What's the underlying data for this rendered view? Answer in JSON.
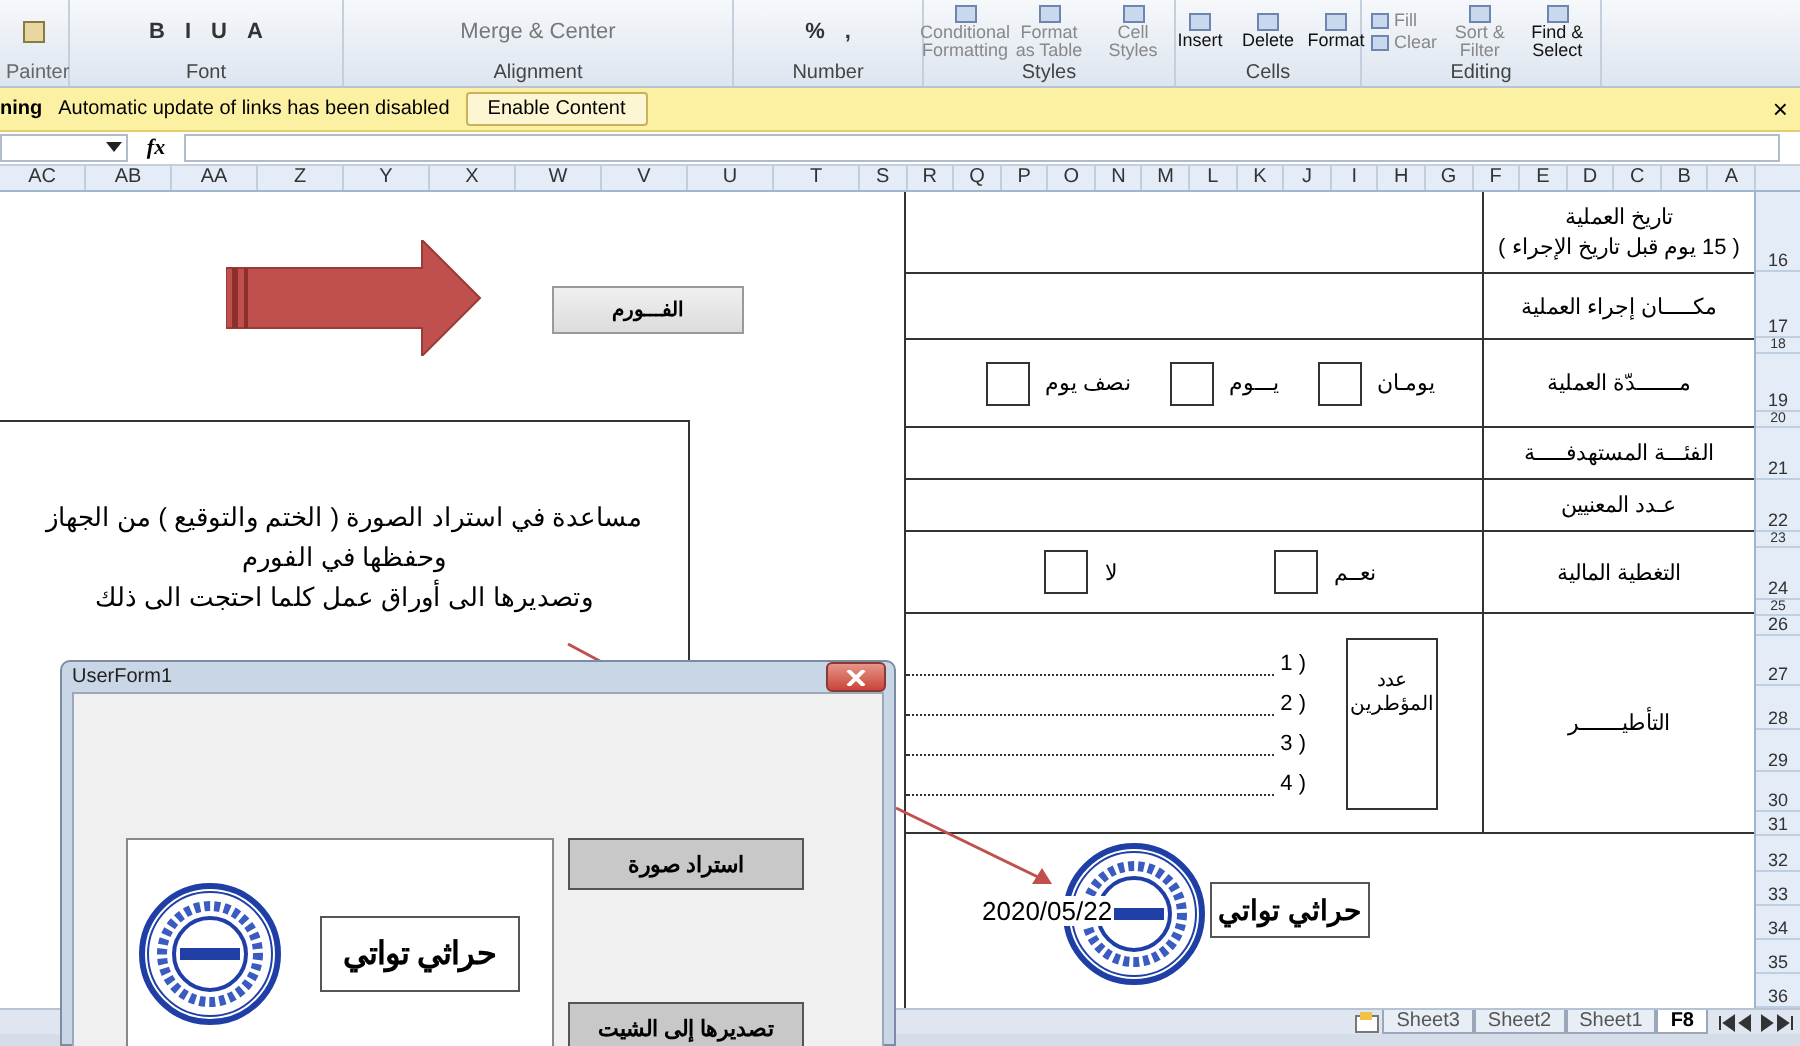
{
  "ribbon": {
    "groups": [
      {
        "label": "Editing",
        "kind": "editing",
        "stack": [
          {
            "label": "Fill",
            "disabled": true
          },
          {
            "label": "Clear",
            "disabled": true
          }
        ],
        "items": [
          {
            "label": "Find & Select",
            "disabled": false
          },
          {
            "label": "Sort & Filter",
            "disabled": true
          }
        ]
      },
      {
        "label": "Cells",
        "kind": "large",
        "items": [
          {
            "label": "Format",
            "disabled": false
          },
          {
            "label": "Delete",
            "disabled": false
          },
          {
            "label": "Insert",
            "disabled": false
          }
        ]
      },
      {
        "label": "Styles",
        "kind": "large",
        "items": [
          {
            "label": "Cell Styles",
            "disabled": true
          },
          {
            "label": "Format as Table",
            "disabled": true
          },
          {
            "label": "Conditional Formatting",
            "disabled": true
          }
        ]
      },
      {
        "label": "Number",
        "kind": "small",
        "items": [
          {
            "label": ","
          },
          {
            "label": "%"
          }
        ]
      },
      {
        "label": "Alignment",
        "kind": "small",
        "items": [
          {
            "label": "Merge & Center"
          }
        ]
      },
      {
        "label": "Font",
        "kind": "small",
        "items": [
          {
            "label": "A"
          },
          {
            "label": "U"
          },
          {
            "label": "I"
          },
          {
            "label": "B"
          }
        ]
      },
      {
        "label": "Painter",
        "kind": "clip"
      }
    ]
  },
  "message_bar": {
    "title": "ning",
    "text": "Automatic update of links has been disabled",
    "button": "Enable Content",
    "close": "×"
  },
  "formula_bar": {
    "fx": "fx"
  },
  "columns": [
    "A",
    "B",
    "C",
    "D",
    "E",
    "F",
    "G",
    "H",
    "I",
    "J",
    "K",
    "L",
    "M",
    "N",
    "O",
    "P",
    "Q",
    "R",
    "S",
    "T",
    "U",
    "V",
    "W",
    "X",
    "Y",
    "Z",
    "AA",
    "AB",
    "AC"
  ],
  "rows": [
    "16",
    "17",
    "18",
    "19",
    "20",
    "21",
    "22",
    "23",
    "24",
    "25",
    "26",
    "27",
    "28",
    "29",
    "30",
    "31",
    "32",
    "33",
    "34",
    "35",
    "36"
  ],
  "form": {
    "rows": [
      {
        "label": "تاريخ العملية",
        "note": "( 15 يوم قبل تاريخ الإجراء )"
      },
      {
        "label": "مكـــــان إجراء العملية"
      },
      {
        "label": "مـــــــدّة العملية",
        "options": [
          {
            "label": "يومـان",
            "checked": false
          },
          {
            "label": "يـــوم",
            "checked": false
          },
          {
            "label": "نصف يوم",
            "checked": false
          }
        ]
      },
      {
        "label": "الفئـــة المستهدفـــــة"
      },
      {
        "label": "عـدد المعنيين"
      },
      {
        "label": "التغطية المالية",
        "options": [
          {
            "label": "نعــم",
            "checked": false
          },
          {
            "label": "لا",
            "checked": false
          }
        ]
      },
      {
        "label": "التأطيـــــــر",
        "box": "عدد المؤطرين",
        "lines": [
          "1 )",
          "2 )",
          "3 )",
          "4 )"
        ]
      }
    ]
  },
  "form_button": "الفـــورم",
  "note_lines": [
    "مساعدة في استراد الصورة ( الختم والتوقيع ) من الجهاز",
    "وحفظها في الفورم",
    "وتصديرها الى أوراق عمل كلما احتجت الى ذلك"
  ],
  "signature": {
    "date": "2020/05/22",
    "name": "حراثي تواتي"
  },
  "userform": {
    "title": "UserForm1",
    "name": "حراثي تواتي",
    "buttons": [
      "استراد صورة",
      "تصديرها إلى الشيت"
    ]
  },
  "sheet_tabs": [
    {
      "label": "F8",
      "selected": true
    },
    {
      "label": "Sheet1",
      "selected": false
    },
    {
      "label": "Sheet2",
      "selected": false
    },
    {
      "label": "Sheet3",
      "selected": false
    }
  ]
}
